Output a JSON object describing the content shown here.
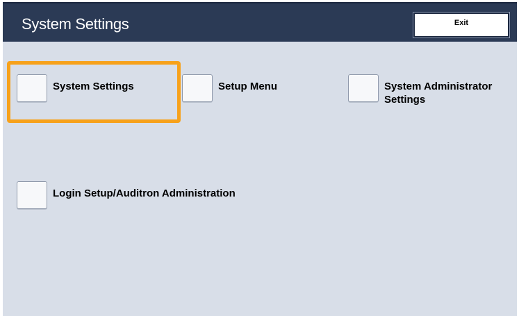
{
  "header": {
    "title": "System Settings",
    "exit_label": "Exit"
  },
  "options": [
    {
      "label": "System Settings"
    },
    {
      "label": "Setup Menu"
    },
    {
      "label_line1": "System Administrator",
      "label_line2": "Settings"
    },
    {
      "label": "Login Setup/Auditron Administration"
    }
  ],
  "colors": {
    "title_bar": "#2b3a55",
    "background": "#d8dee8",
    "highlight": "#f7a11a"
  }
}
